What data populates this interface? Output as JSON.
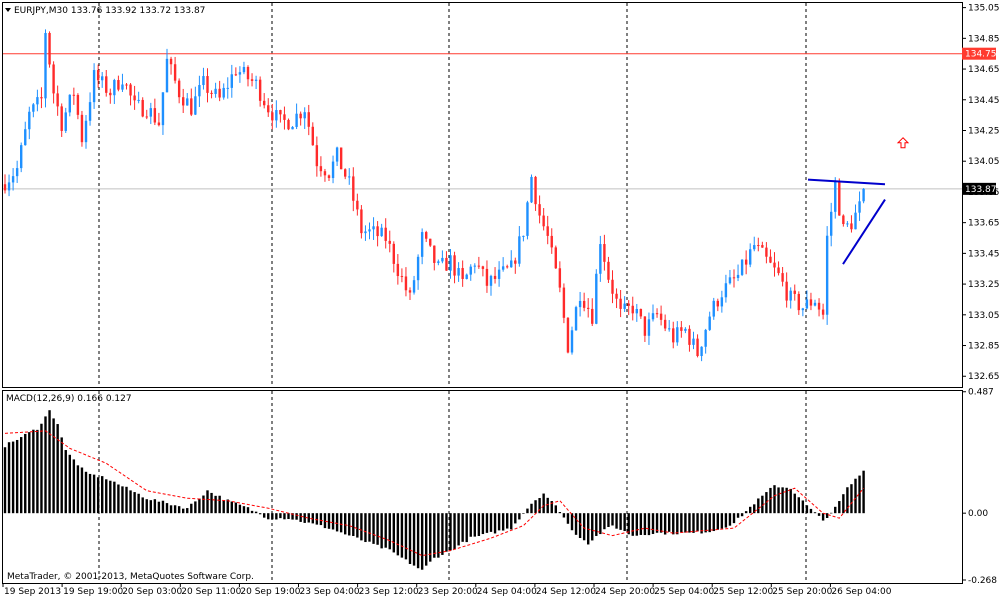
{
  "colors": {
    "bull": "#1e90ff",
    "bear": "#ff2a2a",
    "resistance": "#ff3b30",
    "trendline": "#0000cc",
    "price_line": "#c0c0c0",
    "macd_hist": "#000000",
    "macd_signal": "#ff0000",
    "arrow": "#ff0000"
  },
  "chart_data": [
    {
      "type": "candlestick",
      "title": "EURJPY,M30 133.76 133.92 133.72 133.87",
      "ylim": [
        132.58,
        135.08
      ],
      "yticks": [
        "135.05",
        "134.85",
        "134.65",
        "134.45",
        "134.25",
        "134.05",
        "133.85",
        "133.65",
        "133.45",
        "133.25",
        "133.05",
        "132.85",
        "132.65"
      ],
      "x_labels": [
        "19 Sep 2013",
        "19 Sep 19:00",
        "20 Sep 03:00",
        "20 Sep 11:00",
        "20 Sep 19:00",
        "23 Sep 04:00",
        "23 Sep 12:00",
        "23 Sep 20:00",
        "24 Sep 04:00",
        "24 Sep 12:00",
        "24 Sep 20:00",
        "25 Sep 04:00",
        "25 Sep 12:00",
        "25 Sep 20:00",
        "26 Sep 04:00"
      ],
      "anchors": [
        [
          0,
          133.92
        ],
        [
          3,
          134.0
        ],
        [
          6,
          134.35
        ],
        [
          9,
          134.45
        ],
        [
          10,
          134.9
        ],
        [
          12,
          134.5
        ],
        [
          14,
          134.3
        ],
        [
          17,
          134.5
        ],
        [
          19,
          134.2
        ],
        [
          22,
          134.6
        ],
        [
          26,
          134.5
        ],
        [
          29,
          134.6
        ],
        [
          32,
          134.4
        ],
        [
          35,
          134.4
        ],
        [
          38,
          134.3
        ],
        [
          40,
          134.7
        ],
        [
          43,
          134.5
        ],
        [
          46,
          134.4
        ],
        [
          49,
          134.55
        ],
        [
          53,
          134.45
        ],
        [
          57,
          134.65
        ],
        [
          62,
          134.55
        ],
        [
          65,
          134.4
        ],
        [
          68,
          134.3
        ],
        [
          71,
          134.32
        ],
        [
          74,
          134.4
        ],
        [
          77,
          134.05
        ],
        [
          80,
          133.98
        ],
        [
          82,
          134.08
        ],
        [
          85,
          133.9
        ],
        [
          88,
          133.6
        ],
        [
          91,
          133.58
        ],
        [
          94,
          133.55
        ],
        [
          97,
          133.35
        ],
        [
          100,
          133.15
        ],
        [
          103,
          133.55
        ],
        [
          107,
          133.35
        ],
        [
          110,
          133.4
        ],
        [
          113,
          133.25
        ],
        [
          116,
          133.4
        ],
        [
          119,
          133.25
        ],
        [
          122,
          133.3
        ],
        [
          125,
          133.35
        ],
        [
          128,
          133.6
        ],
        [
          130,
          133.95
        ],
        [
          132,
          133.7
        ],
        [
          134,
          133.55
        ],
        [
          137,
          133.2
        ],
        [
          139,
          132.85
        ],
        [
          142,
          133.2
        ],
        [
          145,
          133.05
        ],
        [
          147,
          133.55
        ],
        [
          149,
          133.3
        ],
        [
          152,
          133.05
        ],
        [
          155,
          133.1
        ],
        [
          158,
          132.95
        ],
        [
          161,
          133.05
        ],
        [
          165,
          132.9
        ],
        [
          168,
          132.95
        ],
        [
          171,
          132.8
        ],
        [
          174,
          133.05
        ],
        [
          177,
          133.2
        ],
        [
          181,
          133.3
        ],
        [
          185,
          133.5
        ],
        [
          188,
          133.4
        ],
        [
          191,
          133.3
        ],
        [
          194,
          133.15
        ],
        [
          197,
          133.1
        ],
        [
          200,
          133.15
        ],
        [
          202,
          133.05
        ],
        [
          203,
          133.55
        ],
        [
          205,
          133.9
        ],
        [
          207,
          133.6
        ],
        [
          209,
          133.65
        ],
        [
          211,
          133.75
        ],
        [
          212,
          133.87
        ]
      ],
      "last_price": "133.87",
      "resistance": {
        "value": 134.75,
        "label": "134.75"
      },
      "triangle_upper": [
        [
          808.0,
          133.93
        ],
        [
          885.0,
          133.9
        ]
      ],
      "triangle_lower": [
        [
          843.0,
          133.38
        ],
        [
          885.0,
          133.8
        ]
      ],
      "arrow_at": [
        903.0,
        134.17
      ],
      "watermark": "MetaTrader, © 2001-2013, MetaQuotes Software Corp."
    },
    {
      "type": "bar",
      "title": "MACD(12,26,9) 0.166 0.127",
      "ylim": [
        -0.28,
        0.49
      ],
      "yticks": [
        "0.487",
        "0.00",
        "-0.268"
      ],
      "anchors": [
        [
          0,
          0.27
        ],
        [
          8,
          0.34
        ],
        [
          11,
          0.41
        ],
        [
          13,
          0.36
        ],
        [
          15,
          0.25
        ],
        [
          20,
          0.16
        ],
        [
          25,
          0.14
        ],
        [
          30,
          0.1
        ],
        [
          35,
          0.06
        ],
        [
          40,
          0.04
        ],
        [
          45,
          0.02
        ],
        [
          50,
          0.09
        ],
        [
          55,
          0.05
        ],
        [
          60,
          0.02
        ],
        [
          65,
          -0.02
        ],
        [
          70,
          -0.02
        ],
        [
          75,
          -0.04
        ],
        [
          80,
          -0.06
        ],
        [
          90,
          -0.12
        ],
        [
          95,
          -0.15
        ],
        [
          100,
          -0.2
        ],
        [
          103,
          -0.23
        ],
        [
          106,
          -0.18
        ],
        [
          110,
          -0.15
        ],
        [
          115,
          -0.1
        ],
        [
          120,
          -0.08
        ],
        [
          125,
          -0.06
        ],
        [
          130,
          0.04
        ],
        [
          133,
          0.08
        ],
        [
          137,
          0.01
        ],
        [
          140,
          -0.07
        ],
        [
          144,
          -0.12
        ],
        [
          147,
          -0.08
        ],
        [
          150,
          -0.05
        ],
        [
          155,
          -0.09
        ],
        [
          160,
          -0.08
        ],
        [
          170,
          -0.08
        ],
        [
          175,
          -0.07
        ],
        [
          180,
          -0.04
        ],
        [
          185,
          0.04
        ],
        [
          190,
          0.11
        ],
        [
          194,
          0.1
        ],
        [
          198,
          0.03
        ],
        [
          202,
          -0.03
        ],
        [
          205,
          0.02
        ],
        [
          208,
          0.1
        ],
        [
          212,
          0.17
        ]
      ],
      "signal_anchors": [
        [
          0,
          0.32
        ],
        [
          10,
          0.33
        ],
        [
          16,
          0.26
        ],
        [
          25,
          0.2
        ],
        [
          35,
          0.09
        ],
        [
          45,
          0.06
        ],
        [
          55,
          0.05
        ],
        [
          65,
          0.02
        ],
        [
          75,
          -0.02
        ],
        [
          85,
          -0.05
        ],
        [
          95,
          -0.11
        ],
        [
          103,
          -0.17
        ],
        [
          110,
          -0.15
        ],
        [
          120,
          -0.1
        ],
        [
          128,
          -0.05
        ],
        [
          133,
          0.03
        ],
        [
          137,
          0.05
        ],
        [
          143,
          -0.06
        ],
        [
          150,
          -0.09
        ],
        [
          158,
          -0.06
        ],
        [
          165,
          -0.08
        ],
        [
          180,
          -0.06
        ],
        [
          190,
          0.07
        ],
        [
          195,
          0.1
        ],
        [
          202,
          0.0
        ],
        [
          206,
          -0.02
        ],
        [
          212,
          0.1
        ]
      ]
    }
  ]
}
